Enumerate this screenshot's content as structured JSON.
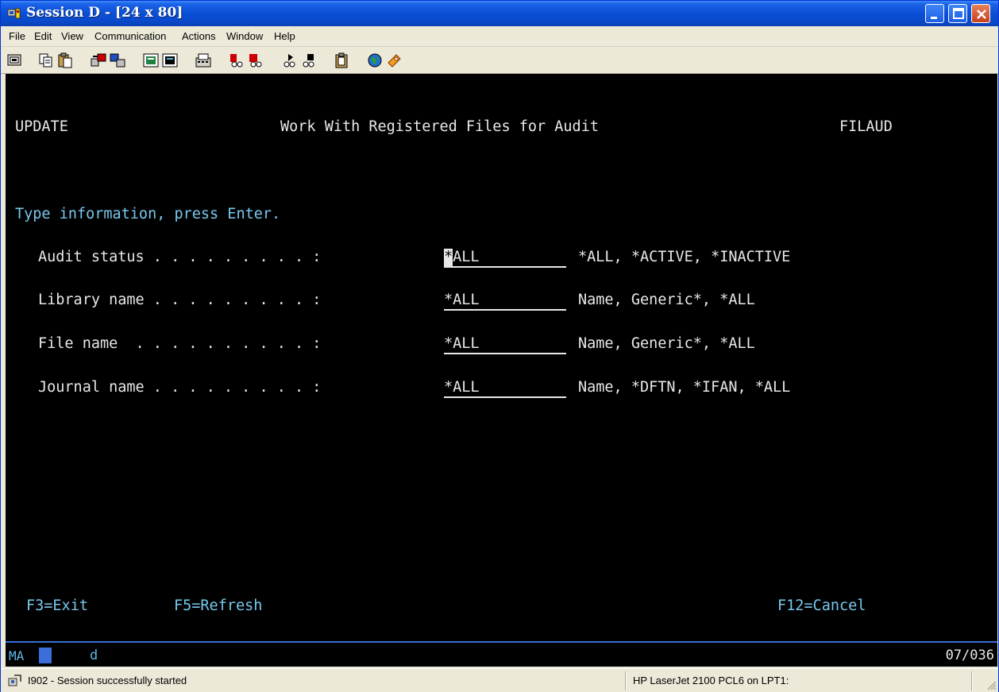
{
  "window": {
    "title": "Session D - [24 x 80]"
  },
  "menu": {
    "items": [
      "File",
      "Edit",
      "View",
      "Communication",
      "Actions",
      "Window",
      "Help"
    ]
  },
  "toolbar": {
    "icons": [
      "print-screen-icon",
      "copy-icon",
      "paste-icon",
      "send-file-icon",
      "receive-file-icon",
      "display-keypad-icon",
      "display-macro-icon",
      "keyboard-map-icon",
      "record-macro-icon",
      "stop-macro-icon",
      "play-macro-icon",
      "pause-macro-icon",
      "clipboard-icon",
      "globe-icon",
      "help-icon"
    ]
  },
  "screen": {
    "mode": "UPDATE",
    "title": "Work With Registered Files for Audit",
    "program": "FILAUD",
    "instruction": "Type information, press Enter.",
    "fields": [
      {
        "label": "Audit status . . . . . . . . . :",
        "value": "*ALL",
        "hint": "*ALL, *ACTIVE, *INACTIVE"
      },
      {
        "label": "Library name . . . . . . . . . :",
        "value": "*ALL",
        "hint": "Name, Generic*, *ALL"
      },
      {
        "label": "File name  . . . . . . . . . . :",
        "value": "*ALL",
        "hint": "Name, Generic*, *ALL"
      },
      {
        "label": "Journal name . . . . . . . . . :",
        "value": "*ALL",
        "hint": "Name, *DFTN, *IFAN, *ALL"
      }
    ],
    "fkeys": {
      "exit": "F3=Exit",
      "refresh": "F5=Refresh",
      "cancel": "F12=Cancel"
    }
  },
  "oia": {
    "ma": "MA",
    "indicator": "d",
    "cursor_position": "07/036"
  },
  "status": {
    "message": "I902 - Session successfully started",
    "printer": "HP LaserJet 2100 PCL6 on LPT1:"
  }
}
